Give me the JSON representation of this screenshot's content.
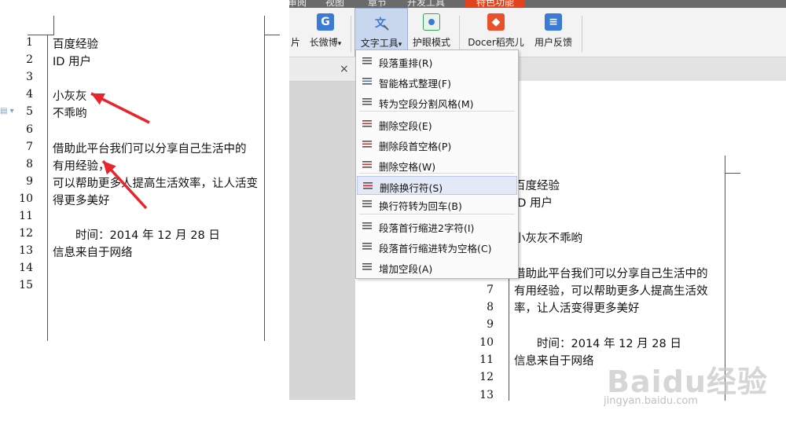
{
  "left_doc": {
    "line_numbers": [
      "1",
      "2",
      "3",
      "4",
      "5",
      "6",
      "7",
      "8",
      "9",
      "10",
      "11",
      "12",
      "13",
      "14",
      "15"
    ],
    "lines": [
      "百度经验",
      "ID 用户",
      "",
      "小灰灰",
      "不乖哟",
      "",
      "借助此平台我们可以分享自己生活中的",
      "有用经验，",
      "可以帮助更多人提高生活效率，让人活变",
      "得更多美好",
      "",
      "时间：2014 年 12 月 28 日",
      "信息来自于网络",
      "",
      ""
    ],
    "arrow_color": "#e8242c"
  },
  "ribbon": {
    "tabs": [
      "审阅",
      "视图",
      "章节",
      "开发工具",
      "特色功能"
    ],
    "active_tab_color": "#e2421c"
  },
  "toolbar": {
    "partial_label": "片",
    "buttons": [
      {
        "label": "长微博",
        "icon": "weibo-icon",
        "color": "#3a7bd5"
      },
      {
        "label": "文字工具",
        "icon": "text-tools-icon",
        "color": "#3a7bd5"
      },
      {
        "label": "护眼模式",
        "icon": "eye-care-icon",
        "color": "#3aa35a"
      },
      {
        "label": "Docer稻壳儿",
        "icon": "docer-icon",
        "color": "#e8522a"
      },
      {
        "label": "用户反馈",
        "icon": "feedback-icon",
        "color": "#3a7bd5"
      }
    ],
    "dropdown_caret": "▾",
    "close_glyph": "×"
  },
  "menu": {
    "items": [
      {
        "label": "段落重排(R)",
        "icon": "paragraph-rearrange-icon"
      },
      {
        "label": "智能格式整理(F)",
        "icon": "smart-format-icon"
      },
      {
        "label": "转为空段分割风格(M)",
        "icon": "empty-paragraph-split-icon"
      },
      {
        "label": "删除空段(E)",
        "icon": "delete-empty-paragraph-icon"
      },
      {
        "label": "删除段首空格(P)",
        "icon": "delete-leading-space-icon"
      },
      {
        "label": "删除空格(W)",
        "icon": "delete-space-icon"
      },
      {
        "label": "删除换行符(S)",
        "icon": "delete-line-break-icon"
      },
      {
        "label": "换行符转为回车(B)",
        "icon": "line-break-to-enter-icon"
      },
      {
        "label": "段落首行缩进2字符(I)",
        "icon": "first-line-indent-icon"
      },
      {
        "label": "段落首行缩进转为空格(C)",
        "icon": "indent-to-space-icon"
      },
      {
        "label": "增加空段(A)",
        "icon": "add-empty-paragraph-icon"
      }
    ],
    "hover_index": 6
  },
  "right_doc": {
    "line_numbers": [
      "7",
      "8",
      "9",
      "10",
      "11",
      "12",
      "13"
    ],
    "lines": [
      "百度经验",
      "ID 用户",
      "",
      "小灰灰不乖哟",
      "",
      "借助此平台我们可以分享自己生活中的",
      "有用经验，可以帮助更多人提高生活效",
      "率，让人活变得更多美好",
      "",
      "时间：2014 年 12 月 28 日",
      "信息来自于网络",
      "",
      ""
    ]
  },
  "watermark": {
    "logo": "Baidu经验",
    "url": "jingyan.baidu.com"
  }
}
